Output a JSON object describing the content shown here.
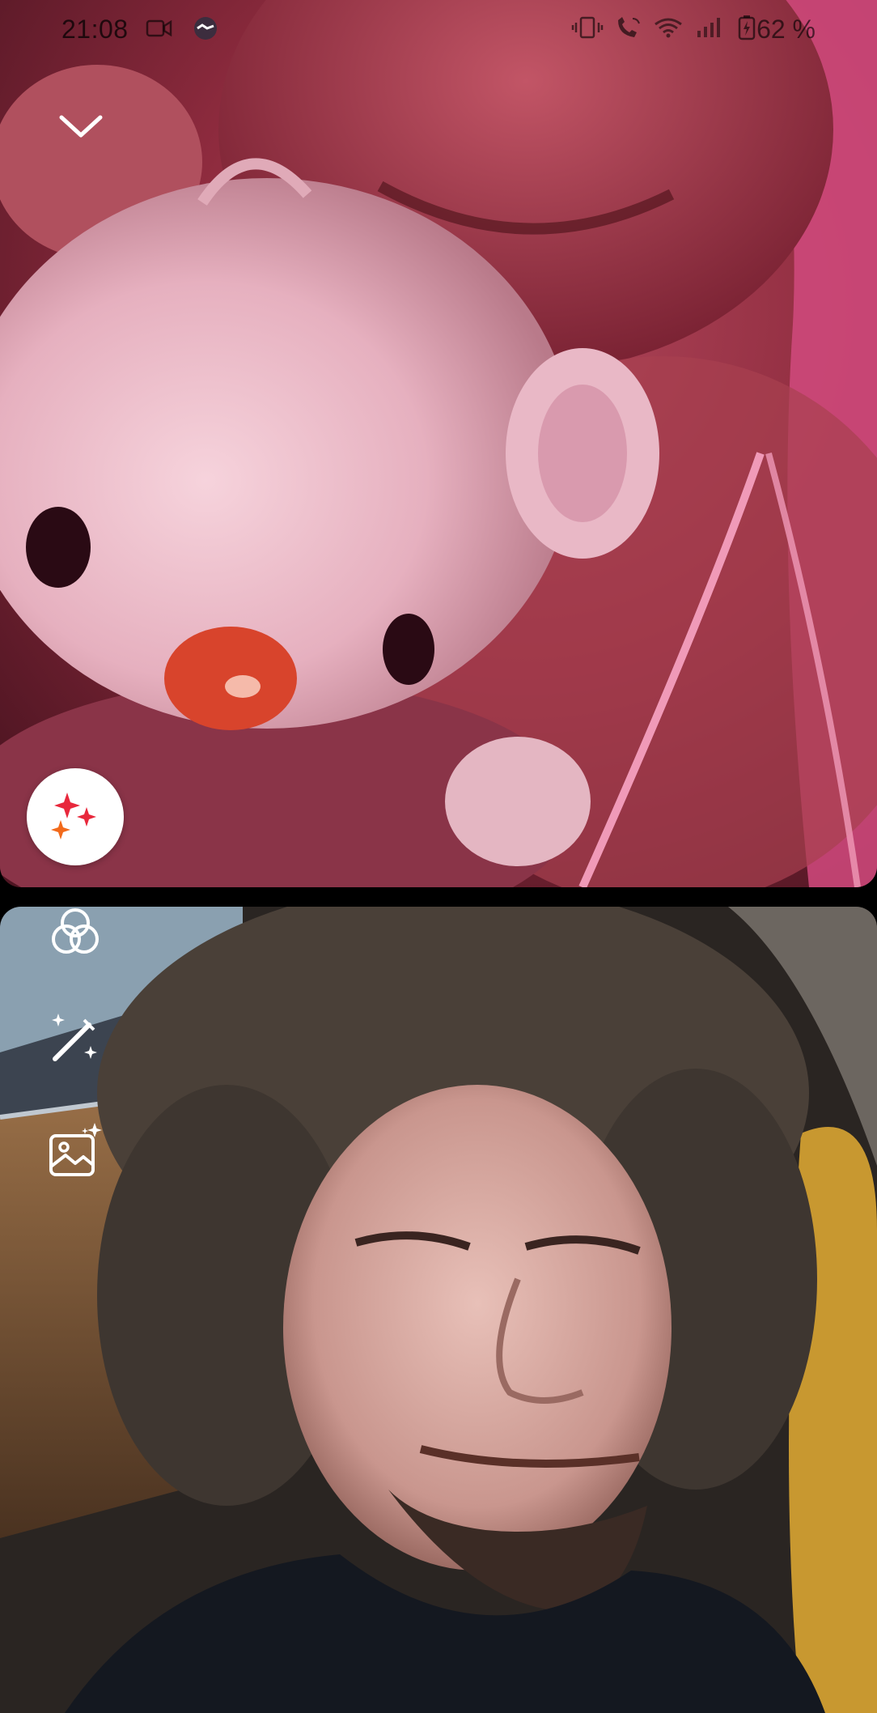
{
  "status_bar": {
    "time": "21:08",
    "battery_percent": "62 %",
    "left_icons": [
      "video-camera-icon",
      "handshake-icon"
    ],
    "right_icons": [
      "vibrate-icon",
      "call-wifi-icon",
      "wifi-icon",
      "signal-icon",
      "battery-charging-icon"
    ]
  },
  "controls": {
    "collapse_icon": "chevron-down-icon",
    "effects_icon": "sparkles-icon",
    "tools": [
      "filters-icon",
      "magic-wand-icon",
      "image-sparkle-icon"
    ]
  },
  "colors": {
    "sparkle_red": "#e8283c",
    "sparkle_orange": "#f26a1b",
    "overlay_icon": "#ffffff"
  }
}
